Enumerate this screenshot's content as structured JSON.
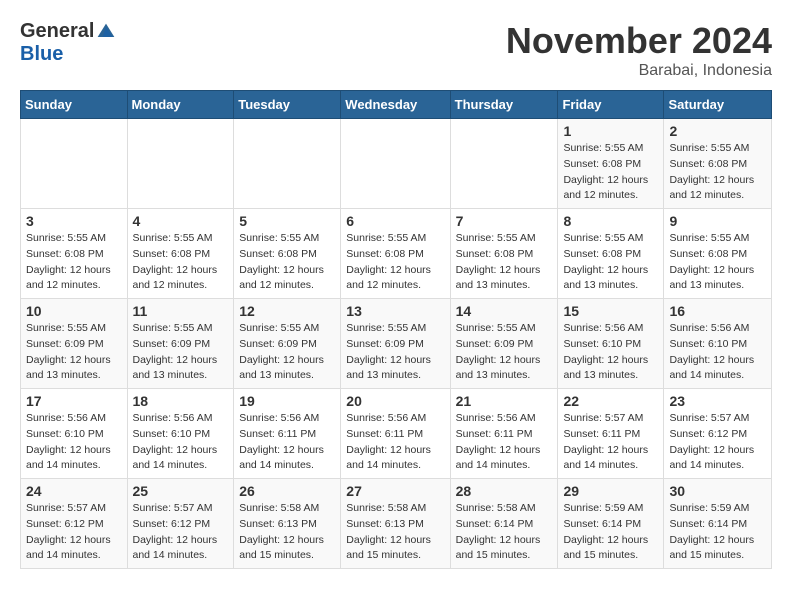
{
  "header": {
    "logo_general": "General",
    "logo_blue": "Blue",
    "month_title": "November 2024",
    "subtitle": "Barabai, Indonesia"
  },
  "days_of_week": [
    "Sunday",
    "Monday",
    "Tuesday",
    "Wednesday",
    "Thursday",
    "Friday",
    "Saturday"
  ],
  "weeks": [
    [
      {
        "day": "",
        "info": ""
      },
      {
        "day": "",
        "info": ""
      },
      {
        "day": "",
        "info": ""
      },
      {
        "day": "",
        "info": ""
      },
      {
        "day": "",
        "info": ""
      },
      {
        "day": "1",
        "info": "Sunrise: 5:55 AM\nSunset: 6:08 PM\nDaylight: 12 hours and 12 minutes."
      },
      {
        "day": "2",
        "info": "Sunrise: 5:55 AM\nSunset: 6:08 PM\nDaylight: 12 hours and 12 minutes."
      }
    ],
    [
      {
        "day": "3",
        "info": "Sunrise: 5:55 AM\nSunset: 6:08 PM\nDaylight: 12 hours and 12 minutes."
      },
      {
        "day": "4",
        "info": "Sunrise: 5:55 AM\nSunset: 6:08 PM\nDaylight: 12 hours and 12 minutes."
      },
      {
        "day": "5",
        "info": "Sunrise: 5:55 AM\nSunset: 6:08 PM\nDaylight: 12 hours and 12 minutes."
      },
      {
        "day": "6",
        "info": "Sunrise: 5:55 AM\nSunset: 6:08 PM\nDaylight: 12 hours and 12 minutes."
      },
      {
        "day": "7",
        "info": "Sunrise: 5:55 AM\nSunset: 6:08 PM\nDaylight: 12 hours and 13 minutes."
      },
      {
        "day": "8",
        "info": "Sunrise: 5:55 AM\nSunset: 6:08 PM\nDaylight: 12 hours and 13 minutes."
      },
      {
        "day": "9",
        "info": "Sunrise: 5:55 AM\nSunset: 6:08 PM\nDaylight: 12 hours and 13 minutes."
      }
    ],
    [
      {
        "day": "10",
        "info": "Sunrise: 5:55 AM\nSunset: 6:09 PM\nDaylight: 12 hours and 13 minutes."
      },
      {
        "day": "11",
        "info": "Sunrise: 5:55 AM\nSunset: 6:09 PM\nDaylight: 12 hours and 13 minutes."
      },
      {
        "day": "12",
        "info": "Sunrise: 5:55 AM\nSunset: 6:09 PM\nDaylight: 12 hours and 13 minutes."
      },
      {
        "day": "13",
        "info": "Sunrise: 5:55 AM\nSunset: 6:09 PM\nDaylight: 12 hours and 13 minutes."
      },
      {
        "day": "14",
        "info": "Sunrise: 5:55 AM\nSunset: 6:09 PM\nDaylight: 12 hours and 13 minutes."
      },
      {
        "day": "15",
        "info": "Sunrise: 5:56 AM\nSunset: 6:10 PM\nDaylight: 12 hours and 13 minutes."
      },
      {
        "day": "16",
        "info": "Sunrise: 5:56 AM\nSunset: 6:10 PM\nDaylight: 12 hours and 14 minutes."
      }
    ],
    [
      {
        "day": "17",
        "info": "Sunrise: 5:56 AM\nSunset: 6:10 PM\nDaylight: 12 hours and 14 minutes."
      },
      {
        "day": "18",
        "info": "Sunrise: 5:56 AM\nSunset: 6:10 PM\nDaylight: 12 hours and 14 minutes."
      },
      {
        "day": "19",
        "info": "Sunrise: 5:56 AM\nSunset: 6:11 PM\nDaylight: 12 hours and 14 minutes."
      },
      {
        "day": "20",
        "info": "Sunrise: 5:56 AM\nSunset: 6:11 PM\nDaylight: 12 hours and 14 minutes."
      },
      {
        "day": "21",
        "info": "Sunrise: 5:56 AM\nSunset: 6:11 PM\nDaylight: 12 hours and 14 minutes."
      },
      {
        "day": "22",
        "info": "Sunrise: 5:57 AM\nSunset: 6:11 PM\nDaylight: 12 hours and 14 minutes."
      },
      {
        "day": "23",
        "info": "Sunrise: 5:57 AM\nSunset: 6:12 PM\nDaylight: 12 hours and 14 minutes."
      }
    ],
    [
      {
        "day": "24",
        "info": "Sunrise: 5:57 AM\nSunset: 6:12 PM\nDaylight: 12 hours and 14 minutes."
      },
      {
        "day": "25",
        "info": "Sunrise: 5:57 AM\nSunset: 6:12 PM\nDaylight: 12 hours and 14 minutes."
      },
      {
        "day": "26",
        "info": "Sunrise: 5:58 AM\nSunset: 6:13 PM\nDaylight: 12 hours and 15 minutes."
      },
      {
        "day": "27",
        "info": "Sunrise: 5:58 AM\nSunset: 6:13 PM\nDaylight: 12 hours and 15 minutes."
      },
      {
        "day": "28",
        "info": "Sunrise: 5:58 AM\nSunset: 6:14 PM\nDaylight: 12 hours and 15 minutes."
      },
      {
        "day": "29",
        "info": "Sunrise: 5:59 AM\nSunset: 6:14 PM\nDaylight: 12 hours and 15 minutes."
      },
      {
        "day": "30",
        "info": "Sunrise: 5:59 AM\nSunset: 6:14 PM\nDaylight: 12 hours and 15 minutes."
      }
    ]
  ]
}
